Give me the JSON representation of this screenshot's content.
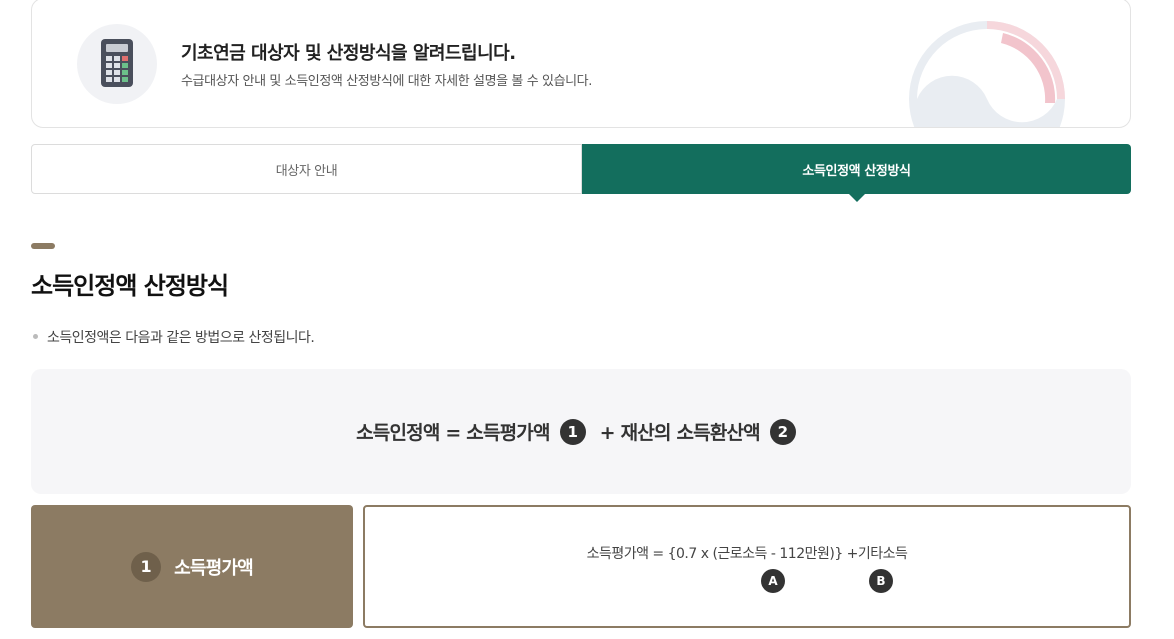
{
  "hero": {
    "title": "기초연금 대상자 및 산정방식을 알려드립니다.",
    "subtitle": "수급대상자 안내 및 소득인정액 산정방식에 대한 자세한 설명을 볼 수 있습니다.",
    "icon": "calculator-icon"
  },
  "tabs": [
    {
      "label": "대상자 안내",
      "active": false
    },
    {
      "label": "소득인정액 산정방식",
      "active": true
    }
  ],
  "section": {
    "title": "소득인정액 산정방식",
    "bullet": "소득인정액은 다음과 같은 방법으로 산정됩니다."
  },
  "formula": {
    "part1": "소득인정액 = 소득평가액",
    "num1": "1",
    "part2": "+ 재산의 소득환산액",
    "num2": "2"
  },
  "item1": {
    "num": "1",
    "label": "소득평가액",
    "formula": "소득평가액 = {0.7 x (근로소득 - 112만원)} +기타소득",
    "marker_a": "A",
    "marker_b": "B"
  },
  "colors": {
    "accent_green": "#136e5d",
    "accent_brown": "#8c7b63",
    "dark_circle": "#333333"
  }
}
